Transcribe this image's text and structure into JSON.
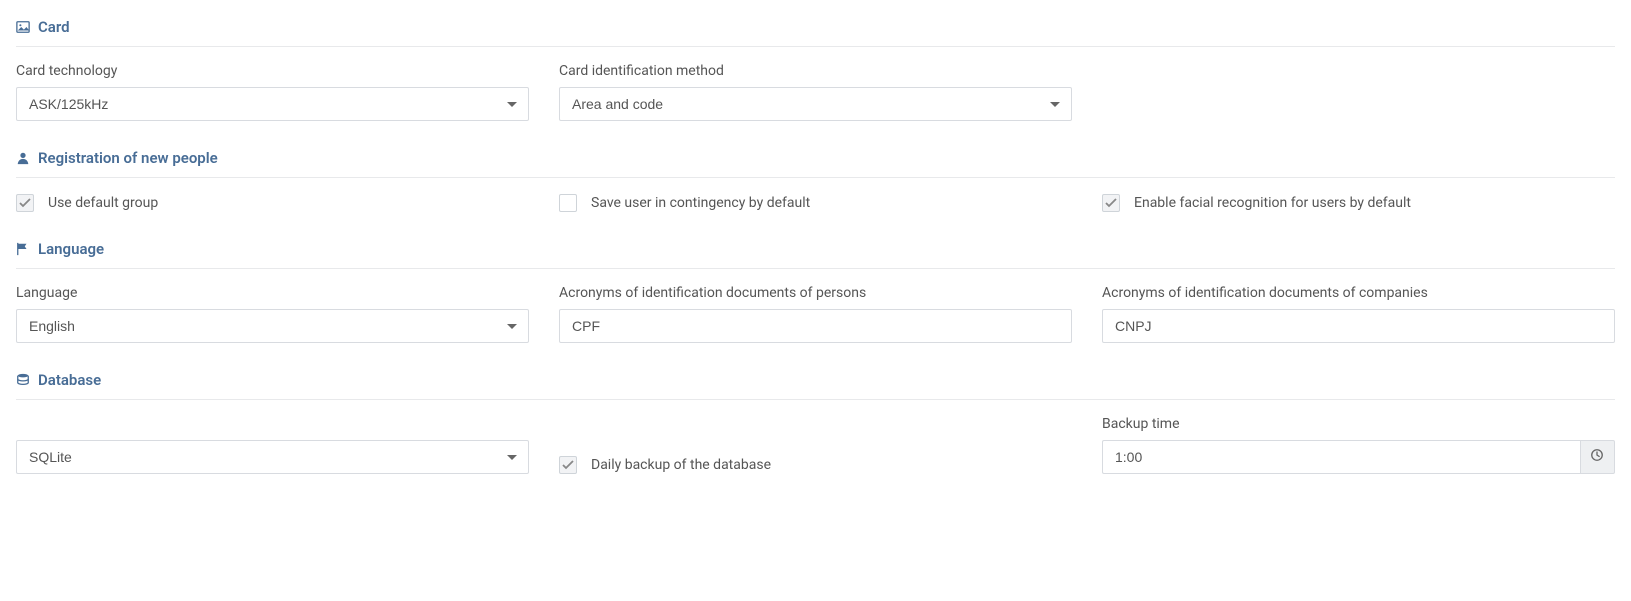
{
  "card": {
    "title": "Card",
    "tech_label": "Card technology",
    "tech_value": "ASK/125kHz",
    "idmethod_label": "Card identification method",
    "idmethod_value": "Area and code"
  },
  "registration": {
    "title": "Registration of new people",
    "use_default_group_label": "Use default group",
    "use_default_group_checked": true,
    "save_contingency_label": "Save user in contingency by default",
    "save_contingency_checked": false,
    "facial_label": "Enable facial recognition for users by default",
    "facial_checked": true
  },
  "language": {
    "title": "Language",
    "lang_label": "Language",
    "lang_value": "English",
    "persons_label": "Acronyms of identification documents of persons",
    "persons_value": "CPF",
    "companies_label": "Acronyms of identification documents of companies",
    "companies_value": "CNPJ"
  },
  "database": {
    "title": "Database",
    "engine_value": "SQLite",
    "daily_backup_label": "Daily backup of the database",
    "daily_backup_checked": true,
    "backup_time_label": "Backup time",
    "backup_time_value": "1:00"
  }
}
